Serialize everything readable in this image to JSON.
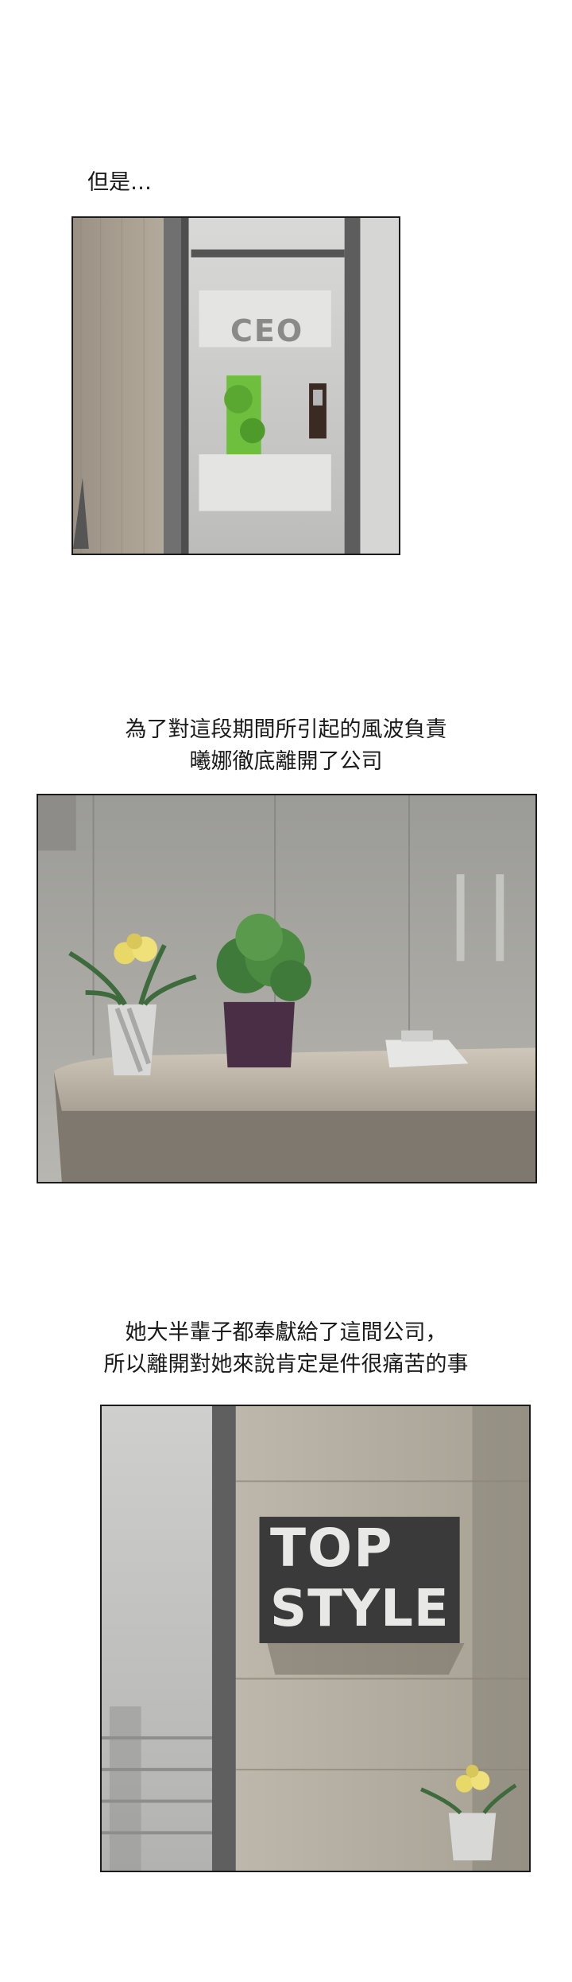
{
  "captions": {
    "c1": "但是…",
    "c2_line1": "為了對這段期間所引起的風波負責",
    "c2_line2": "曦娜徹底離開了公司",
    "c3_line1": "她大半輩子都奉獻給了這間公司，",
    "c3_line2": "所以離開對她來說肯定是件很痛苦的事"
  },
  "panel1": {
    "door_sign": "CEO"
  },
  "panel3": {
    "logo_line1": "TOP",
    "logo_line2": "STYLE"
  }
}
